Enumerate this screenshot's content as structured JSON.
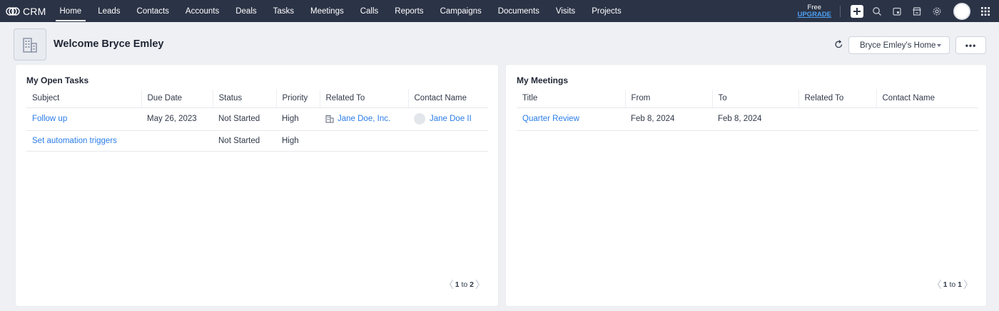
{
  "app": {
    "name": "CRM"
  },
  "nav": {
    "items": [
      {
        "label": "Home",
        "active": true
      },
      {
        "label": "Leads"
      },
      {
        "label": "Contacts"
      },
      {
        "label": "Accounts"
      },
      {
        "label": "Deals"
      },
      {
        "label": "Tasks"
      },
      {
        "label": "Meetings"
      },
      {
        "label": "Calls"
      },
      {
        "label": "Reports"
      },
      {
        "label": "Campaigns"
      },
      {
        "label": "Documents"
      },
      {
        "label": "Visits"
      },
      {
        "label": "Projects"
      }
    ]
  },
  "topbar": {
    "plan_label": "Free",
    "upgrade_label": "UPGRADE",
    "icons": [
      "plus-icon",
      "search-icon",
      "calendar-icon",
      "marketplace-icon",
      "gear-icon",
      "profile-avatar",
      "apps-grid-icon"
    ]
  },
  "header": {
    "welcome": "Welcome Bryce Emley",
    "home_select": "Bryce Emley's Home",
    "more_label": "•••"
  },
  "tasks": {
    "title": "My Open Tasks",
    "columns": [
      "Subject",
      "Due Date",
      "Status",
      "Priority",
      "Related To",
      "Contact Name"
    ],
    "rows": [
      {
        "subject": "Follow up",
        "due": "May 26, 2023",
        "status": "Not Started",
        "priority": "High",
        "related": "Jane Doe, Inc.",
        "contact": "Jane Doe II"
      },
      {
        "subject": "Set automation triggers",
        "due": "",
        "status": "Not Started",
        "priority": "High",
        "related": "",
        "contact": ""
      }
    ],
    "pager": {
      "from": "1",
      "to_label": "to",
      "to": "2"
    }
  },
  "meetings": {
    "title": "My Meetings",
    "columns": [
      "Title",
      "From",
      "To",
      "Related To",
      "Contact Name"
    ],
    "rows": [
      {
        "title": "Quarter Review",
        "from": "Feb 8, 2024",
        "to": "Feb 8, 2024",
        "related": "",
        "contact": ""
      }
    ],
    "pager": {
      "from": "1",
      "to_label": "to",
      "to": "1"
    }
  },
  "colors": {
    "topbar_bg": "#2b3346",
    "link": "#2b7de9",
    "upgrade": "#4ea1f3",
    "page_bg": "#eef0f4"
  }
}
